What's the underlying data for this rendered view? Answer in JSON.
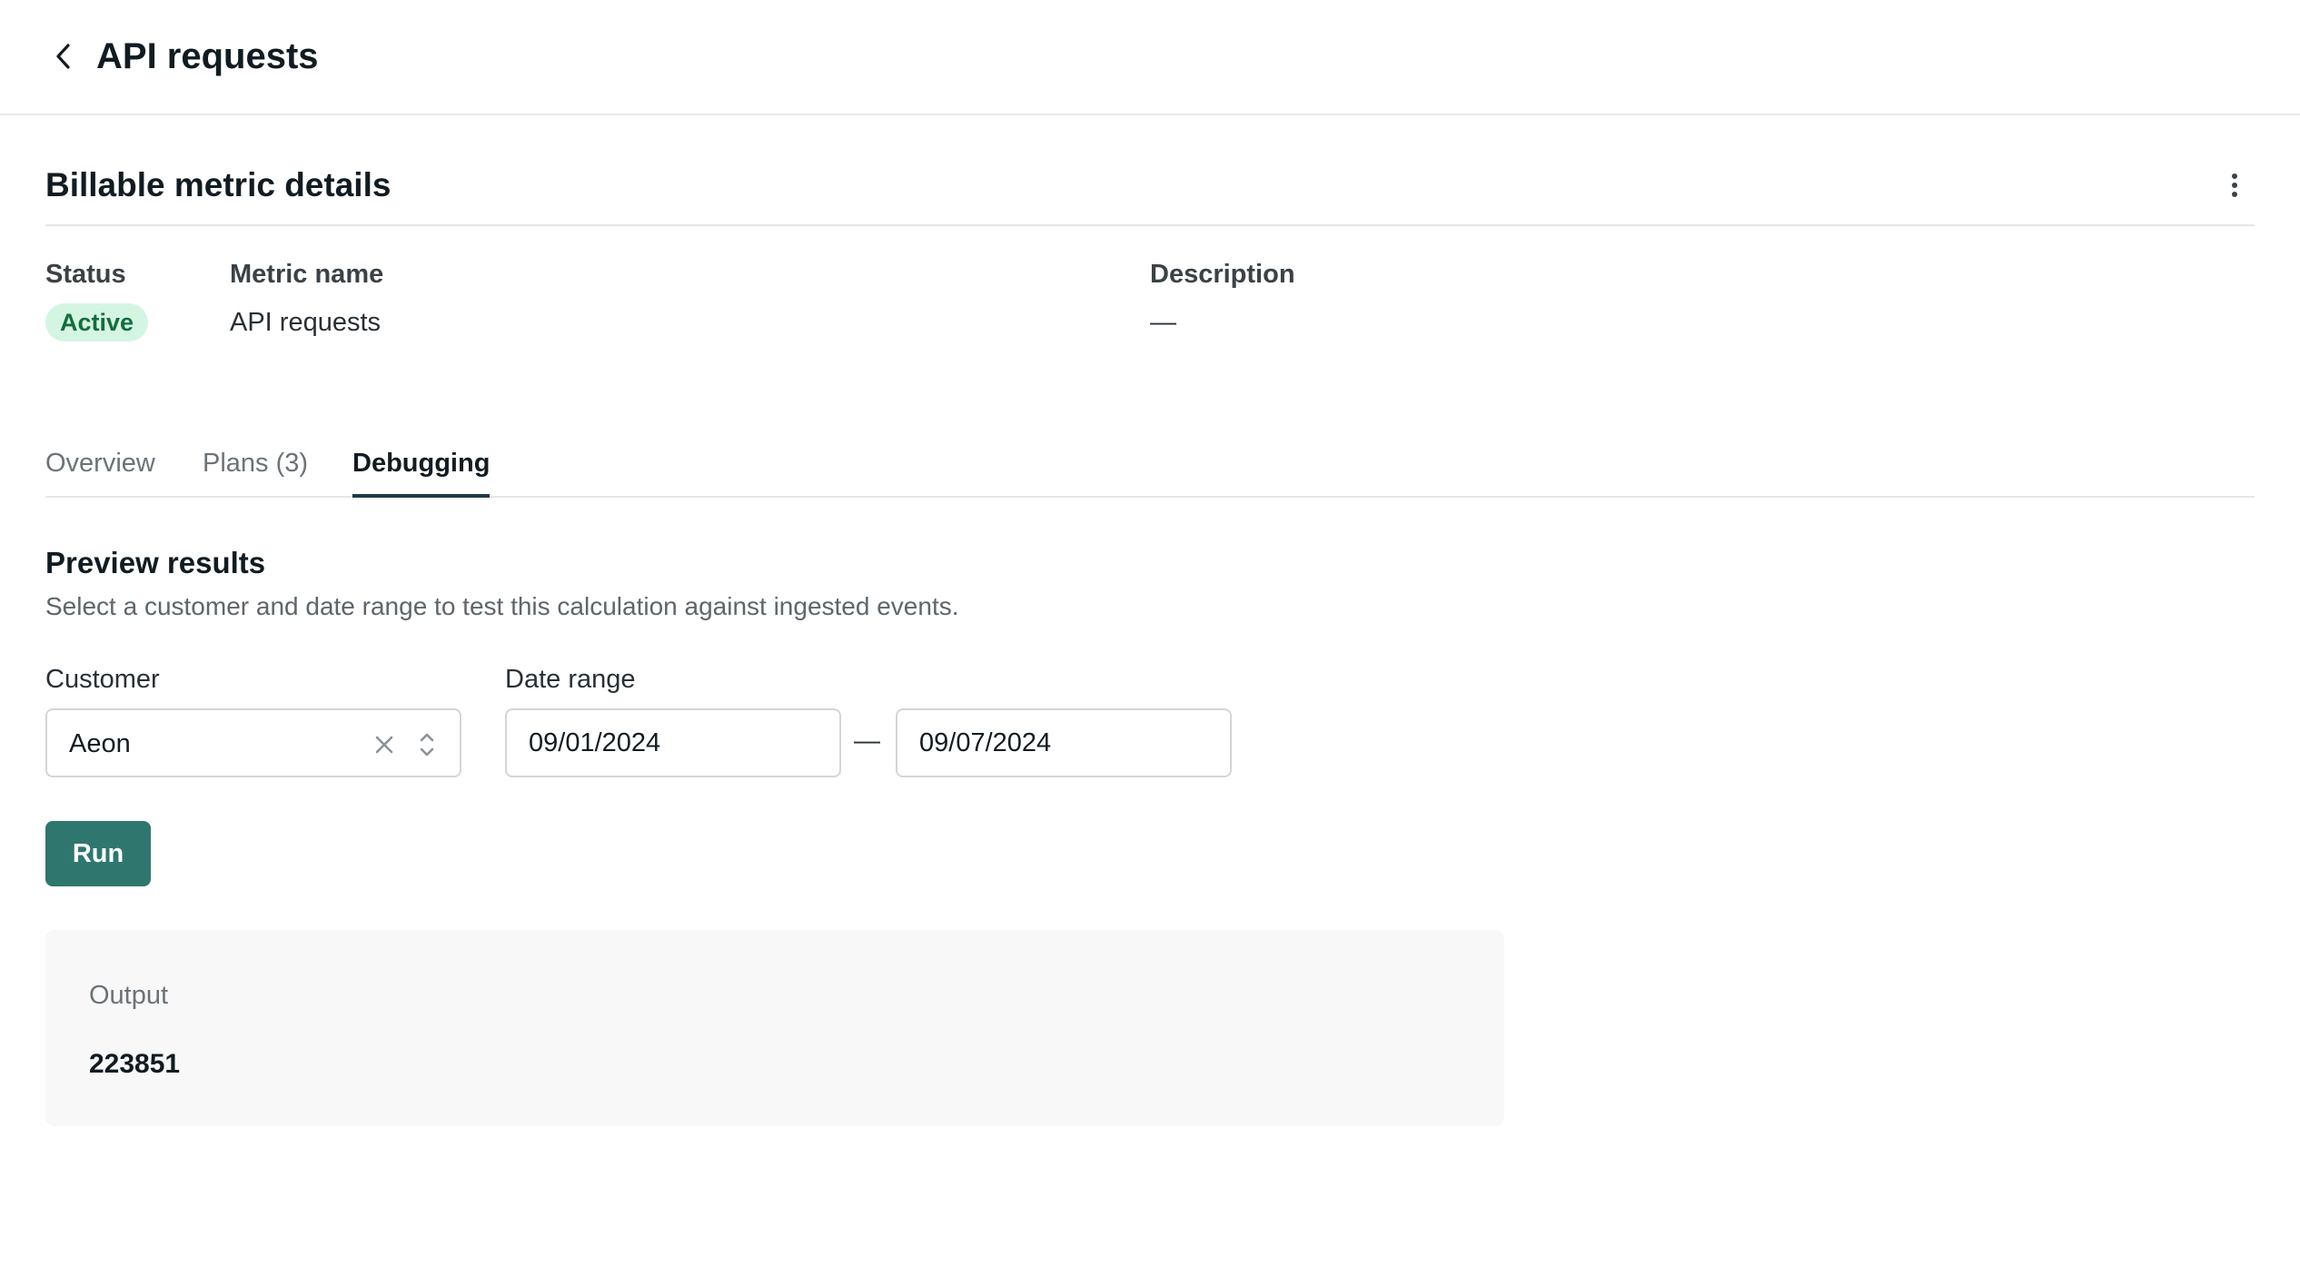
{
  "header": {
    "title": "API requests"
  },
  "section": {
    "title": "Billable metric details"
  },
  "details": {
    "status_label": "Status",
    "status_value": "Active",
    "metric_name_label": "Metric name",
    "metric_name_value": "API requests",
    "description_label": "Description",
    "description_value": "—"
  },
  "tabs": [
    {
      "label": "Overview",
      "active": false
    },
    {
      "label": "Plans (3)",
      "active": false
    },
    {
      "label": "Debugging",
      "active": true
    }
  ],
  "preview": {
    "title": "Preview results",
    "description": "Select a customer and date range to test this calculation against ingested events.",
    "customer_label": "Customer",
    "customer_value": "Aeon",
    "date_range_label": "Date range",
    "date_start": "09/01/2024",
    "date_separator": "—",
    "date_end": "09/07/2024",
    "run_label": "Run"
  },
  "output": {
    "label": "Output",
    "value": "223851"
  },
  "colors": {
    "accent": "#2f766e",
    "status_bg": "#d5f5e3",
    "status_text": "#146d3f",
    "active_tab_underline": "#1f3a46"
  },
  "icons": {
    "back": "chevron-left-icon",
    "more": "more-vertical-icon",
    "clear": "close-icon",
    "select": "chevron-updown-icon"
  }
}
